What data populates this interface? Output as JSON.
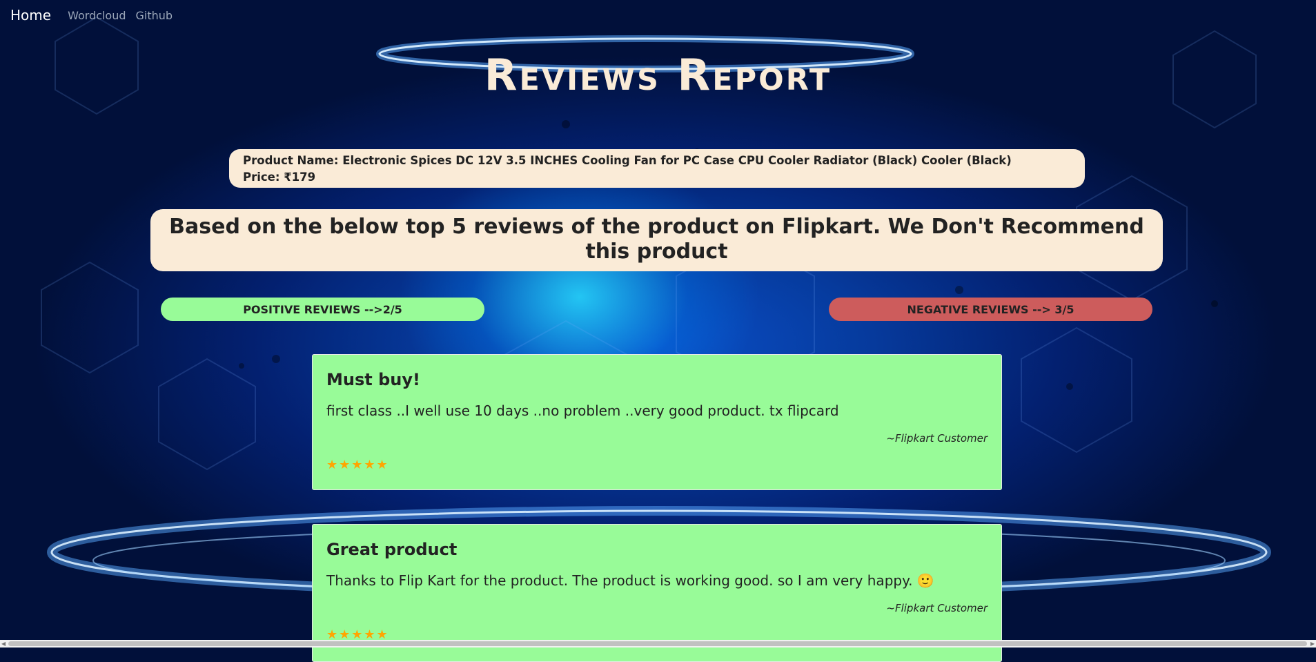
{
  "nav": {
    "home": "Home",
    "wordcloud": "Wordcloud",
    "github": "Github"
  },
  "title": "Reviews Report",
  "product": {
    "name_line": "Product Name: Electronic Spices DC 12V 3.5 INCHES Cooling Fan for PC Case CPU Cooler Radiator (Black) Cooler  (Black)",
    "price_line": "Price: ₹179"
  },
  "verdict": "Based on the below top 5 reviews of the product on Flipkart. We Don't Recommend this product",
  "summary": {
    "positive": "POSITIVE REVIEWS -->2/5",
    "negative": "NEGATIVE REVIEWS --> 3/5",
    "positive_color": "#98fb98",
    "negative_color": "#cd5c5c"
  },
  "reviews": [
    {
      "title": "Must buy!",
      "body": "first class ..I well use 10 days ..no problem ..very good product. tx flipcard",
      "author": "~Flipkart Customer",
      "stars": "★★★★★",
      "rating": 5
    },
    {
      "title": "Great product",
      "body": "Thanks to Flip Kart for the product. The product is working good. so I am very happy. 🙂",
      "author": "~Flipkart Customer",
      "stars": "★★★★★",
      "rating": 5
    }
  ],
  "colors": {
    "accent_cream": "#faebd7",
    "star": "#ffa500"
  }
}
